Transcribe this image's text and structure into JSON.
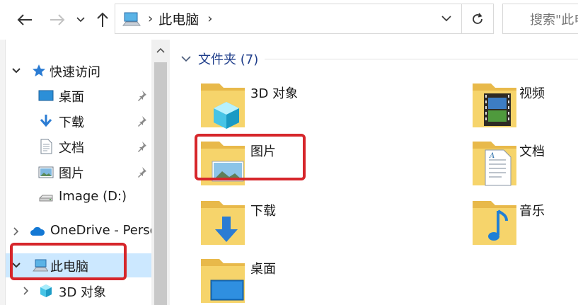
{
  "address_bar": {
    "location": "此电脑",
    "search_placeholder": "搜索\"此电脑\""
  },
  "nav_pane": {
    "quick_access": {
      "label": "快速访问",
      "expanded": true
    },
    "items": [
      {
        "label": "桌面",
        "pinned": true
      },
      {
        "label": "下载",
        "pinned": true
      },
      {
        "label": "文档",
        "pinned": true
      },
      {
        "label": "图片",
        "pinned": true
      },
      {
        "label": "Image (D:)",
        "pinned": false
      }
    ],
    "onedrive": {
      "label": "OneDrive - Perso"
    },
    "this_pc": {
      "label": "此电脑",
      "selected": true
    },
    "sub_3d": {
      "label": "3D 对象"
    }
  },
  "content": {
    "group_label": "文件夹 (7)",
    "folders": [
      {
        "label": "3D 对象",
        "icon": "3d-objects-folder-icon"
      },
      {
        "label": "视频",
        "icon": "videos-folder-icon"
      },
      {
        "label": "图片",
        "icon": "pictures-folder-icon"
      },
      {
        "label": "文档",
        "icon": "documents-folder-icon"
      },
      {
        "label": "下载",
        "icon": "downloads-folder-icon"
      },
      {
        "label": "音乐",
        "icon": "music-folder-icon"
      },
      {
        "label": "桌面",
        "icon": "desktop-folder-icon"
      }
    ]
  },
  "colors": {
    "accent": "#0078d4",
    "selection": "#cce8ff",
    "highlight": "#d6262b",
    "folder": "#f6d46b"
  }
}
